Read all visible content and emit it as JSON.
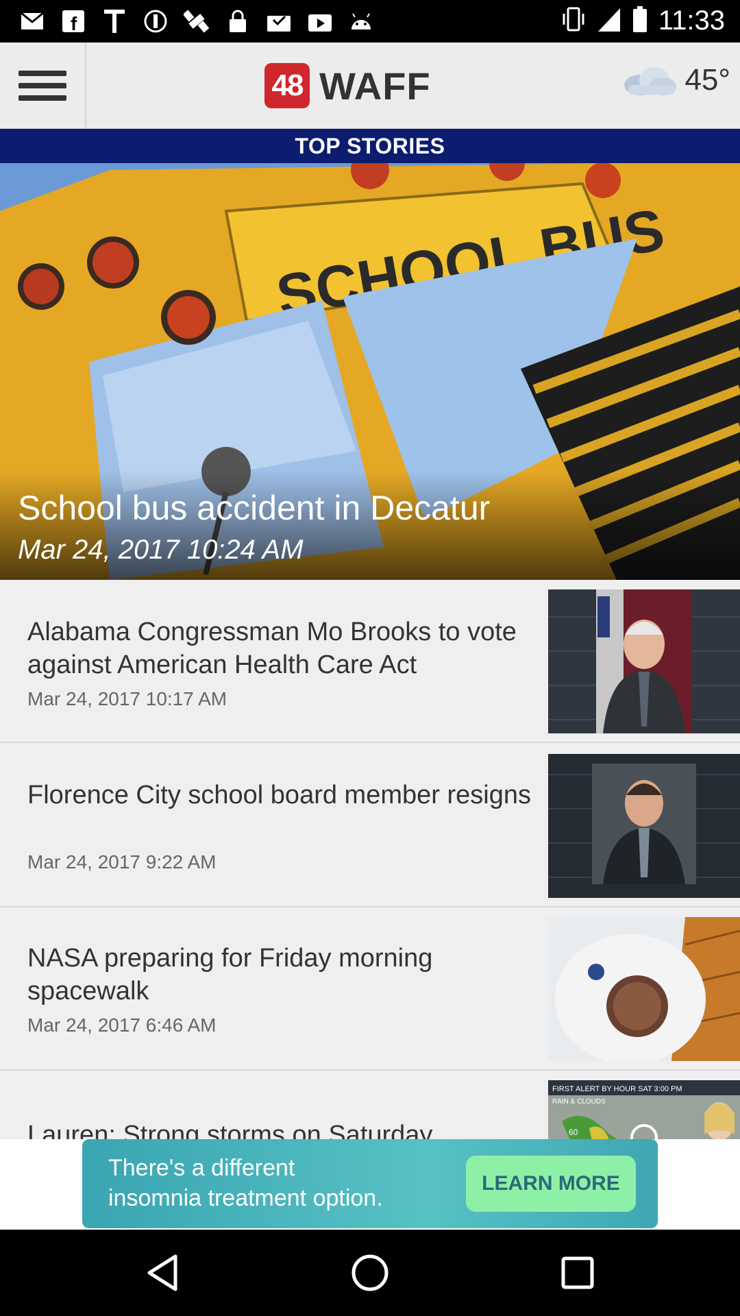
{
  "status_bar": {
    "time": "11:33",
    "icons": [
      "mail-icon",
      "facebook-icon",
      "text-t-icon",
      "circle-info-icon",
      "fake-gps-icon",
      "lock-icon",
      "inbox-check-icon",
      "play-store-icon",
      "android-icon"
    ],
    "right_icons": [
      "vibrate-icon",
      "signal-icon",
      "battery-icon"
    ]
  },
  "header": {
    "logo_number": "48",
    "logo_name": "WAFF",
    "temperature": "45°",
    "weather_icon": "cloudy-icon"
  },
  "section_title": "TOP STORIES",
  "hero": {
    "title": "School bus accident in Decatur",
    "date": "Mar 24, 2017 10:24 AM",
    "bus_sign": "SCHOOL BUS"
  },
  "stories": [
    {
      "headline": "Alabama Congressman Mo Brooks to vote against American Health Care Act",
      "date": "Mar 24, 2017 10:17 AM",
      "thumb": "congressman-portrait"
    },
    {
      "headline": "Florence City school board member resigns",
      "date": "Mar 24, 2017 9:22 AM",
      "thumb": "board-member-portrait"
    },
    {
      "headline": "NASA preparing for Friday morning spacewalk",
      "date": "Mar 24, 2017 6:46 AM",
      "thumb": "astronaut-photo"
    },
    {
      "headline": "Lauren: Strong storms on Saturday",
      "date": "",
      "thumb": "weather-map",
      "thumb_caption": "FIRST ALERT BY HOUR   SAT   3:00 PM",
      "thumb_sub": "RAIN & CLOUDS",
      "thumb_number": "60"
    }
  ],
  "ad": {
    "text_line1": "There's a different",
    "text_line2": "insomnia treatment option.",
    "cta": "LEARN MORE"
  },
  "nav": {
    "back": "back-icon",
    "home": "home-icon",
    "recents": "recents-icon"
  }
}
